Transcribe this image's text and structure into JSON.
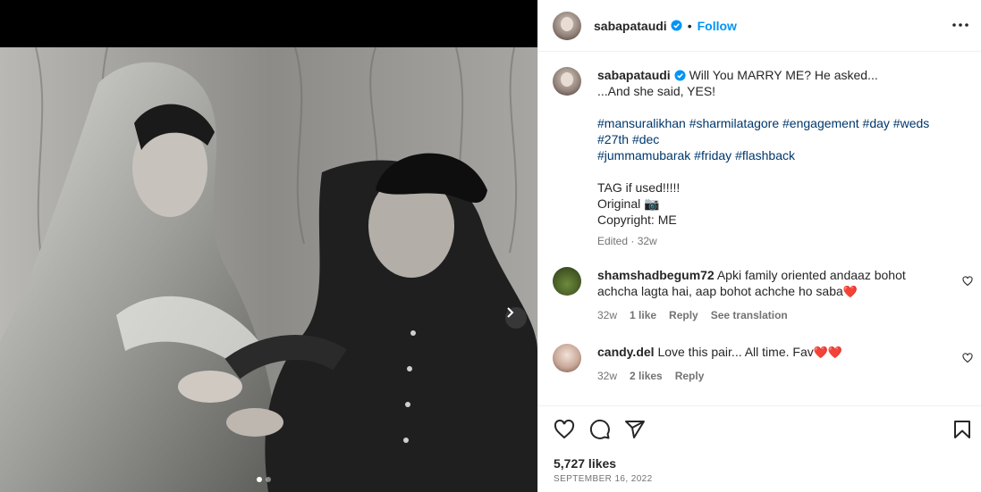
{
  "post": {
    "username": "sabapataudi",
    "follow_label": "Follow",
    "bullet": "•",
    "caption": {
      "line1": "Will You MARRY ME? He asked...",
      "line2": "...And she said, YES!",
      "hashtags_line1": [
        "#mansuralikhan",
        "#sharmilatagore",
        "#engagement",
        "#day",
        "#weds"
      ],
      "hashtags_line2": [
        "#27th",
        "#dec"
      ],
      "hashtags_line3": [
        "#jummamubarak",
        "#friday",
        "#flashback"
      ],
      "line3": "TAG if used!!!!!",
      "line4": "Original 📷",
      "line5": "Copyright: ME",
      "meta": "Edited · 32w"
    },
    "likes": "5,727 likes",
    "date": "SEPTEMBER 16, 2022"
  },
  "comments": [
    {
      "username": "shamshadbegum72",
      "text": "Apki family oriented andaaz bohot achcha lagta hai, aap bohot achche ho saba",
      "emoji": "❤️",
      "time": "32w",
      "likes": "1 like",
      "reply": "Reply",
      "translate": "See translation"
    },
    {
      "username": "candy.del",
      "text": "Love this pair... All time. Fav",
      "emoji": "❤️❤️",
      "time": "32w",
      "likes": "2 likes",
      "reply": "Reply"
    }
  ],
  "icons": {
    "verified": "verified-badge-icon",
    "more": "more-options-icon",
    "like": "heart-icon",
    "comment": "comment-icon",
    "share": "share-icon",
    "save": "bookmark-icon",
    "next": "chevron-right-icon"
  },
  "colors": {
    "accent": "#0095f6",
    "hashtag": "#00376b",
    "muted": "#737373",
    "heart": "#e0162b"
  }
}
